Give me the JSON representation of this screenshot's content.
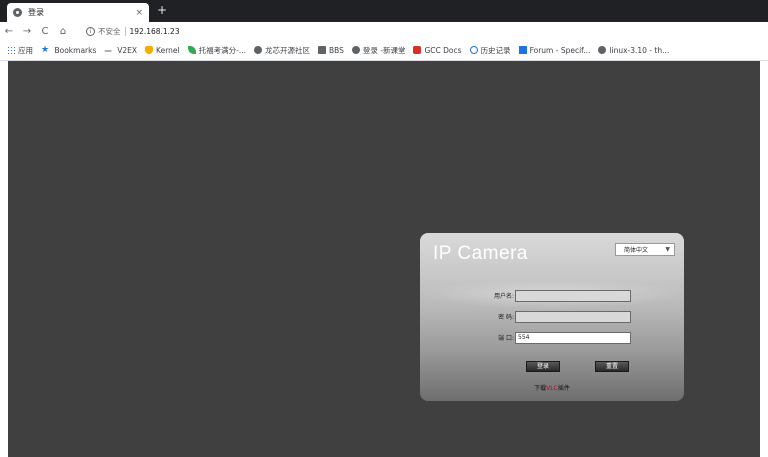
{
  "browser": {
    "tab_title": "登录",
    "tab_close": "×",
    "new_tab": "+",
    "back": "←",
    "forward": "→",
    "reload": "C",
    "home": "⌂",
    "insecure_label": "不安全",
    "url": "192.168.1.23",
    "icons": {
      "tab_favicon": "globe-icon",
      "info": "info-icon"
    }
  },
  "bookmarks": [
    {
      "label": "应用",
      "icon": "apps-icon"
    },
    {
      "label": "Bookmarks",
      "icon": "star-icon"
    },
    {
      "label": "V2EX",
      "icon": "dash-icon"
    },
    {
      "label": "Kernel",
      "icon": "tux-icon"
    },
    {
      "label": "托福考满分-...",
      "icon": "leaf-icon"
    },
    {
      "label": "龙芯开源社区",
      "icon": "globe-icon"
    },
    {
      "label": "BBS",
      "icon": "folder-icon"
    },
    {
      "label": "登录 -新课堂",
      "icon": "globe-icon"
    },
    {
      "label": "GCC Docs",
      "icon": "gcc-icon"
    },
    {
      "label": "历史记录",
      "icon": "history-icon"
    },
    {
      "label": "Forum - Specif...",
      "icon": "forum-icon"
    },
    {
      "label": "linux-3.10 - th...",
      "icon": "globe-icon"
    }
  ],
  "login": {
    "brand": "IP Camera",
    "language": "简体中文",
    "username_label": "用户名:",
    "username_value": "",
    "password_label": "密 码:",
    "password_value": "",
    "port_label": "端 口:",
    "port_value": "554",
    "login_button": "登录",
    "reset_button": "重置",
    "download_prefix": "下载",
    "download_plugin": "VLC",
    "download_suffix": "插件"
  }
}
